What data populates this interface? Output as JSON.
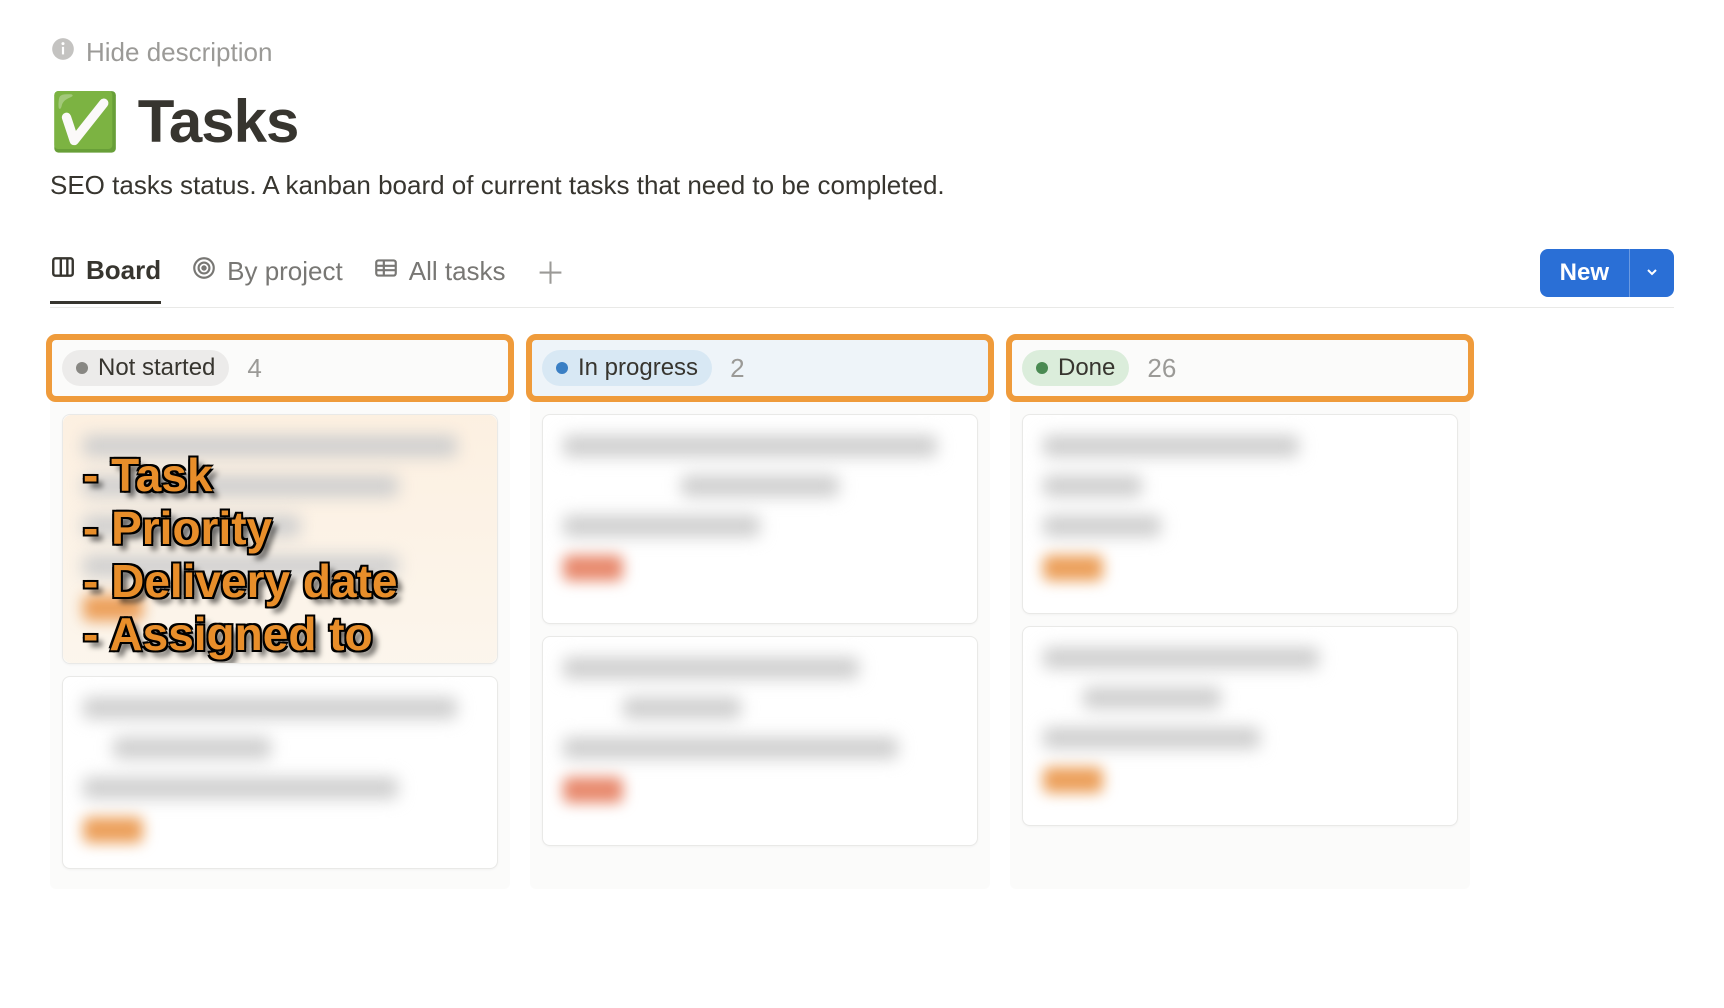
{
  "header": {
    "hide_label": "Hide description",
    "emoji": "✅",
    "title": "Tasks",
    "description": "SEO tasks status. A kanban board of current tasks that need to be completed."
  },
  "tabs": {
    "items": [
      {
        "label": "Board",
        "active": true
      },
      {
        "label": "By project",
        "active": false
      },
      {
        "label": "All tasks",
        "active": false
      }
    ],
    "new_label": "New"
  },
  "columns": [
    {
      "name": "Not started",
      "count": "4",
      "pill": "pill-gray"
    },
    {
      "name": "In progress",
      "count": "2",
      "pill": "pill-blue"
    },
    {
      "name": "Done",
      "count": "26",
      "pill": "pill-green"
    }
  ],
  "annotation": {
    "line1": "- Task",
    "line2": "- Priority",
    "line3": "- Delivery date",
    "line4": "- Assigned to"
  }
}
